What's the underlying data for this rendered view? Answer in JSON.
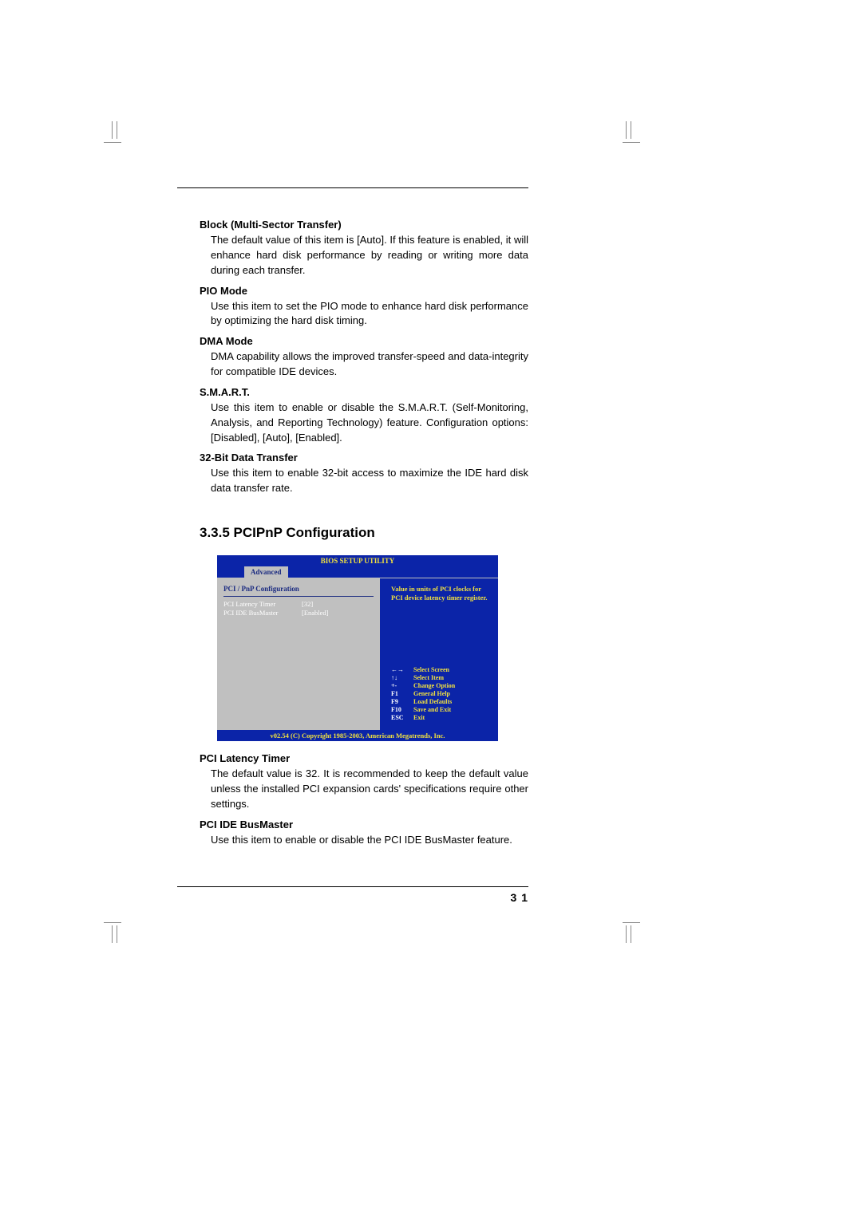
{
  "items": [
    {
      "heading": "Block (Multi-Sector Transfer)",
      "body": "The default value of this item is [Auto]. If this feature is enabled, it will enhance hard disk performance by reading or writing more data during each transfer."
    },
    {
      "heading": "PIO Mode",
      "body": "Use this item to set the PIO mode to enhance hard disk performance by optimizing the hard disk timing."
    },
    {
      "heading": "DMA Mode",
      "body": "DMA capability allows the improved transfer-speed and data-integrity for compatible IDE devices."
    },
    {
      "heading": "S.M.A.R.T.",
      "body": "Use this item to enable or disable the S.M.A.R.T. (Self-Monitoring, Analysis, and Reporting Technology) feature. Configuration options: [Disabled], [Auto], [Enabled]."
    },
    {
      "heading": "32-Bit Data Transfer",
      "body": "Use this item to enable 32-bit access to maximize the IDE hard disk data transfer rate."
    }
  ],
  "section_heading": "3.3.5 PCIPnP Configuration",
  "bios": {
    "title": "BIOS SETUP UTILITY",
    "tab": "Advanced",
    "panel_title": "PCI / PnP Configuration",
    "rows": [
      {
        "k": "PCI Latency Timer",
        "v": "[32]"
      },
      {
        "k": "PCI IDE BusMaster",
        "v": "[Enabled]"
      }
    ],
    "help": "Value in units of PCI clocks for PCI device latency timer register.",
    "nav": [
      {
        "k": "←→",
        "v": "Select Screen"
      },
      {
        "k": "↑↓",
        "v": "Select Item"
      },
      {
        "k": "+-",
        "v": "Change Option"
      },
      {
        "k": "F1",
        "v": "General Help"
      },
      {
        "k": "F9",
        "v": "Load Defaults"
      },
      {
        "k": "F10",
        "v": "Save and Exit"
      },
      {
        "k": "ESC",
        "v": "Exit"
      }
    ],
    "footer": "v02.54 (C) Copyright 1985-2003, American Megatrends, Inc."
  },
  "items2": [
    {
      "heading": "PCI Latency Timer",
      "body": "The default value is 32. It is recommended to keep the default value unless the installed PCI expansion cards' specifications require other settings."
    },
    {
      "heading": "PCI IDE BusMaster",
      "body": "Use this item to enable or disable the PCI IDE BusMaster feature."
    }
  ],
  "page_number": "3 1"
}
